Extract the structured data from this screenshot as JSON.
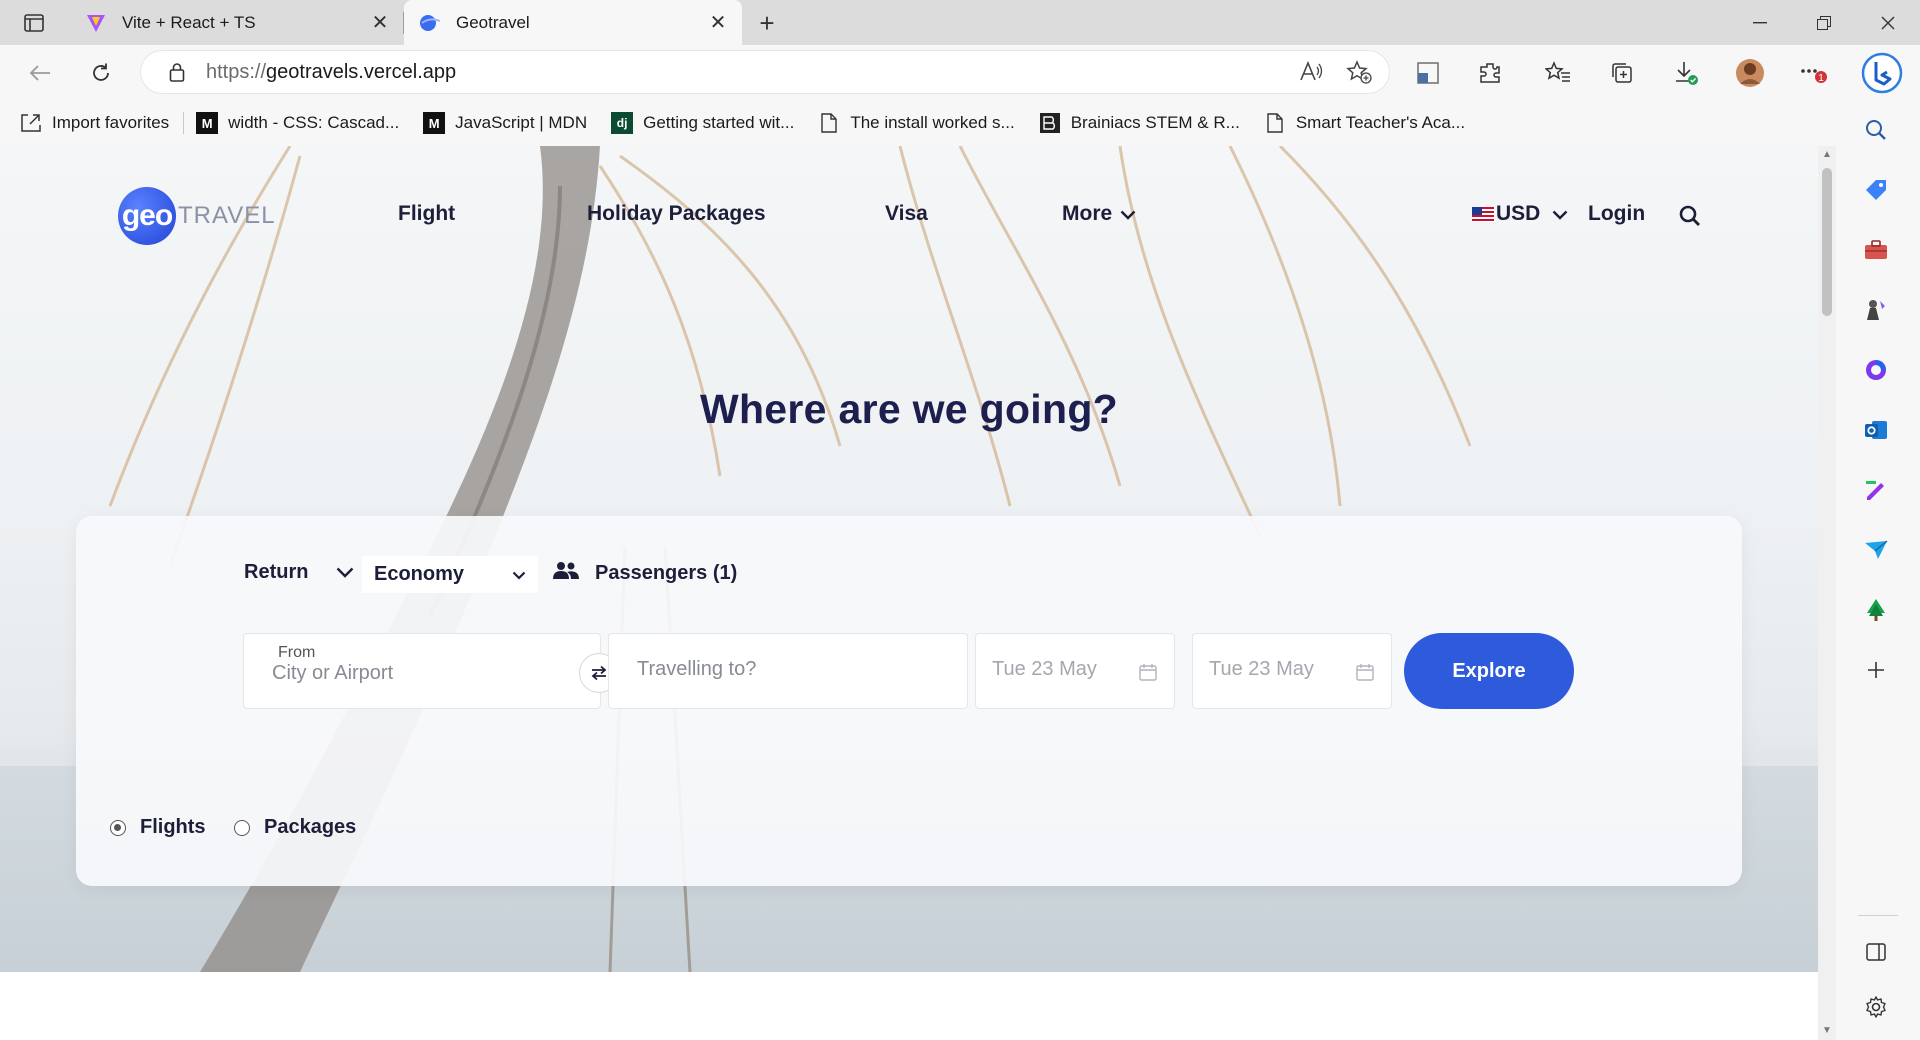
{
  "browser": {
    "tabs": [
      {
        "title": "Vite + React + TS"
      },
      {
        "title": "Geotravel"
      }
    ],
    "url_scheme": "https://",
    "url_host": "geotravels.vercel.app",
    "bookmarks": [
      "Import favorites",
      "width - CSS: Cascad...",
      "JavaScript | MDN",
      "Getting started wit...",
      "The install worked s...",
      "Brainiacs STEM & R...",
      "Smart Teacher's Aca..."
    ],
    "bookmark_icons": [
      "M",
      "M",
      "dj"
    ],
    "notification_count": "1"
  },
  "site": {
    "logo_mark": "geo",
    "logo_word": "TRAVEL",
    "nav": [
      "Flight",
      "Holiday Packages",
      "Visa",
      "More"
    ],
    "currency": "USD",
    "login": "Login",
    "hero_title": "Where are we going?",
    "search": {
      "trip_type": "Return",
      "cabin_class": "Economy",
      "passengers": "Passengers (1)",
      "from_label": "From",
      "from_placeholder": "City or Airport",
      "to_placeholder": "Travelling to?",
      "depart_date": "Tue 23 May",
      "return_date": "Tue 23 May",
      "explore": "Explore"
    },
    "modes": [
      {
        "label": "Flights",
        "selected": true
      },
      {
        "label": "Packages",
        "selected": false
      }
    ]
  },
  "colors": {
    "accent": "#2d5bdb",
    "heading": "#1d1f4f"
  }
}
